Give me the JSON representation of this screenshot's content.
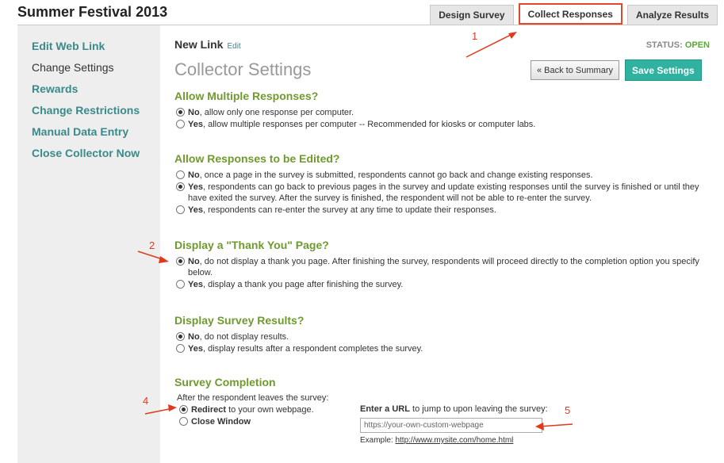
{
  "survey": {
    "title": "Summer Festival 2013"
  },
  "tabs": [
    {
      "label": "Design Survey",
      "active": false
    },
    {
      "label": "Collect Responses",
      "active": true
    },
    {
      "label": "Analyze Results",
      "active": false
    }
  ],
  "sidebar": {
    "items": [
      {
        "label": "Edit Web Link",
        "current": false
      },
      {
        "label": "Change Settings",
        "current": true
      },
      {
        "label": "Rewards",
        "current": false
      },
      {
        "label": "Change Restrictions",
        "current": false
      },
      {
        "label": "Manual Data Entry",
        "current": false
      },
      {
        "label": "Close Collector Now",
        "current": false
      }
    ]
  },
  "header": {
    "link_name": "New Link",
    "edit_label": "Edit",
    "status_label": "STATUS:",
    "status_value": "OPEN",
    "page_title": "Collector Settings",
    "back_button": "« Back to Summary",
    "save_button": "Save Settings"
  },
  "sections": {
    "multiple": {
      "title": "Allow Multiple Responses?",
      "options": [
        {
          "bold": "No",
          "text": ", allow only one response per computer.",
          "selected": true
        },
        {
          "bold": "Yes",
          "text": ", allow multiple responses per computer -- Recommended for kiosks or computer labs.",
          "selected": false
        }
      ]
    },
    "edit": {
      "title": "Allow Responses to be Edited?",
      "options": [
        {
          "bold": "No",
          "text": ", once a page in the survey is submitted, respondents cannot go back and change existing responses.",
          "selected": false
        },
        {
          "bold": "Yes",
          "text": ", respondents can go back to previous pages in the survey and update existing responses until the survey is finished or until they have exited the survey. After the survey is finished, the respondent will not be able to re-enter the survey.",
          "selected": true
        },
        {
          "bold": "Yes",
          "text": ", respondents can re-enter the survey at any time to update their responses.",
          "selected": false
        }
      ]
    },
    "thankyou": {
      "title": "Display a \"Thank You\" Page?",
      "options": [
        {
          "bold": "No",
          "text": ", do not display a thank you page. After finishing the survey, respondents will proceed directly to the completion option you specify below.",
          "selected": true
        },
        {
          "bold": "Yes",
          "text": ", display a thank you page after finishing the survey.",
          "selected": false
        }
      ]
    },
    "results": {
      "title": "Display Survey Results?",
      "options": [
        {
          "bold": "No",
          "text": ", do not display results.",
          "selected": true
        },
        {
          "bold": "Yes",
          "text": ", display results after a respondent completes the survey.",
          "selected": false
        }
      ]
    },
    "completion": {
      "title": "Survey Completion",
      "subtitle": "After the respondent leaves the survey:",
      "options": [
        {
          "bold": "Redirect",
          "text": " to your own webpage.",
          "selected": true
        },
        {
          "bold": "Close Window",
          "text": "",
          "selected": false
        }
      ],
      "url_label_bold": "Enter a URL",
      "url_label_rest": " to jump to upon leaving the survey:",
      "url_value": "https://your-own-custom-webpage",
      "example_label": "Example: ",
      "example_url": "http://www.mysite.com/home.html"
    }
  },
  "annotations": [
    "1",
    "2",
    "4",
    "5"
  ],
  "colors": {
    "accent_green": "#6f9a2e",
    "teal": "#3b8a8a",
    "save_button": "#2fb2a0",
    "annotation_red": "#e03a1e"
  }
}
